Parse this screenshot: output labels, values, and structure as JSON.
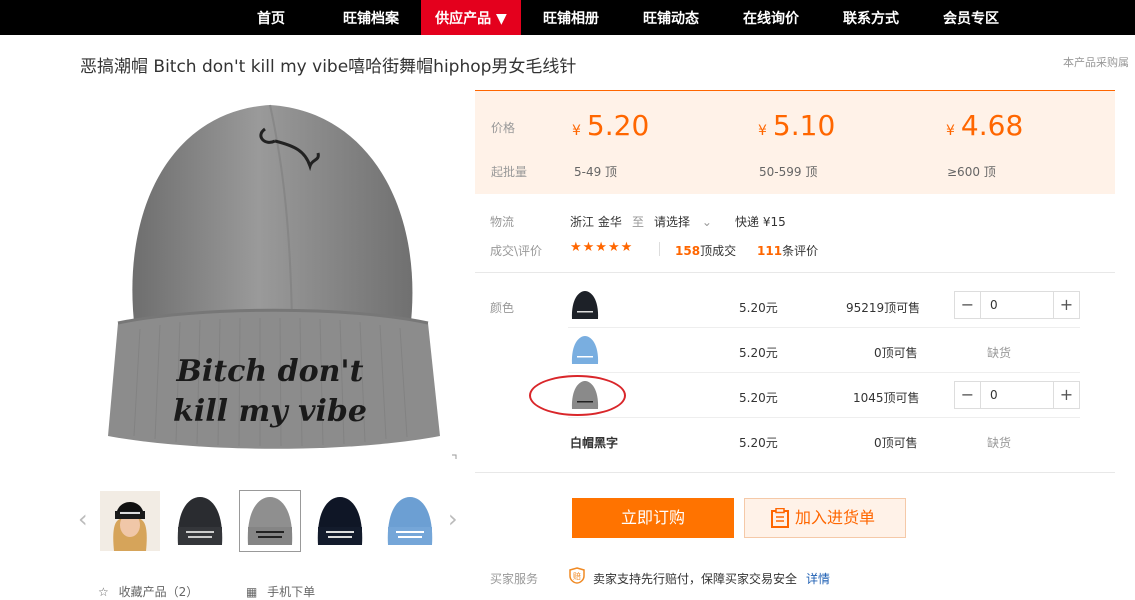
{
  "nav": {
    "items": [
      "首页",
      "旺铺档案",
      "供应产品 ▼",
      "旺铺相册",
      "旺铺动态",
      "在线询价",
      "联系方式",
      "会员专区"
    ]
  },
  "product": {
    "title": "恶搞潮帽 Bitch don't kill my vibe嘻哈街舞帽hiphop男女毛线针",
    "note": "本产品采购属",
    "image_text": [
      "Bitch don't",
      "kill my vibe"
    ]
  },
  "price": {
    "price_label": "价格",
    "moq_label": "起批量",
    "currency": "¥",
    "tiers": [
      {
        "price": "5.20",
        "qty": "5-49 顶"
      },
      {
        "price": "5.10",
        "qty": "50-599 顶"
      },
      {
        "price": "4.68",
        "qty": "≥600 顶"
      }
    ]
  },
  "logistics": {
    "label": "物流",
    "origin": "浙江 金华",
    "to": "至",
    "dest": "请选择",
    "express": "快递 ¥15"
  },
  "trade": {
    "label": "成交\\评价",
    "stars": "★★★★★",
    "deals_num": "158",
    "deals_unit": "顶成交",
    "reviews_num": "111",
    "reviews_unit": "条评价"
  },
  "sku": {
    "label": "颜色",
    "rows": [
      {
        "name": "",
        "price": "5.20元",
        "stock": "95219顶可售",
        "qty": "0",
        "available": true
      },
      {
        "name": "",
        "price": "5.20元",
        "stock": "0顶可售",
        "status": "缺货",
        "available": false
      },
      {
        "name": "",
        "price": "5.20元",
        "stock": "1045顶可售",
        "qty": "0",
        "available": true
      },
      {
        "name": "白帽黑字",
        "price": "5.20元",
        "stock": "0顶可售",
        "status": "缺货",
        "available": false
      }
    ]
  },
  "actions": {
    "buy": "立即订购",
    "add_cart": "加入进货单"
  },
  "service": {
    "label": "买家服务",
    "text": "卖家支持先行赔付，保障买家交易安全",
    "link": "详情"
  },
  "bottom": {
    "favorite": "收藏产品（2）",
    "mobile_order": "手机下单"
  },
  "colors": {
    "accent": "#ff6600",
    "nav_bg": "#000000",
    "nav_active": "#e4001d",
    "price_bg": "#fff2e8",
    "annotation": "#d9262a"
  }
}
